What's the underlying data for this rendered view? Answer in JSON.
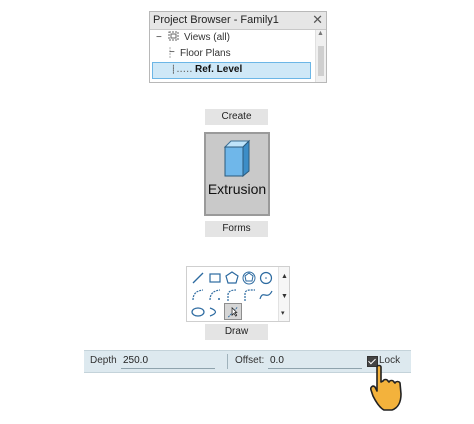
{
  "project_browser": {
    "title": "Project Browser - Family1",
    "tree": [
      {
        "label": "Views (all)",
        "expander": "−"
      },
      {
        "label": "Floor Plans",
        "expander": "−"
      },
      {
        "label": "Ref. Level",
        "selected": true
      }
    ]
  },
  "create_panel": {
    "label": "Create"
  },
  "extrusion_button": {
    "label": "Extrusion",
    "icon": "extrusion-box-icon"
  },
  "forms_panel": {
    "label": "Forms"
  },
  "draw_panel": {
    "label": "Draw",
    "tools": [
      "line-icon",
      "rectangle-icon",
      "polygon-icon",
      "circle-icon",
      "start-end-arc-icon",
      "center-ends-arc-icon",
      "tangent-arc-icon",
      "fillet-arc-icon",
      "spline-icon",
      "ellipse-icon",
      "partial-ellipse-icon",
      "pick-lines-icon"
    ],
    "selected_tool": "pick-lines-icon"
  },
  "options_bar": {
    "depth_label": "Depth",
    "depth_value": "250.0",
    "offset_label": "Offset:",
    "offset_value": "0.0",
    "lock_label": "Lock",
    "lock_checked": true
  },
  "colors": {
    "accent": "#6cb6e6",
    "cursor": "#f3b23c"
  }
}
